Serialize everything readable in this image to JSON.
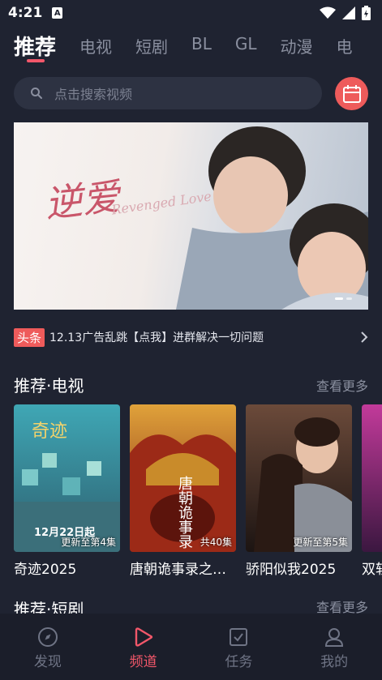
{
  "status_bar": {
    "time": "4:21",
    "notif_badge": "A"
  },
  "tabs": [
    {
      "label": "推荐",
      "active": true
    },
    {
      "label": "电视",
      "active": false
    },
    {
      "label": "短剧",
      "active": false
    },
    {
      "label": "BL",
      "active": false
    },
    {
      "label": "GL",
      "active": false
    },
    {
      "label": "动漫",
      "active": false
    },
    {
      "label": "电",
      "active": false
    }
  ],
  "search": {
    "placeholder": "点击搜索视频"
  },
  "banner": {
    "title_art": "逆爱",
    "subtitle_art": "Revenged Love"
  },
  "notice": {
    "tag": "头条",
    "text": "12.13广告乱跳【点我】进群解决一切问题"
  },
  "section_tv": {
    "title": "推荐·电视",
    "more": "查看更多"
  },
  "cards": [
    {
      "name": "奇迹2025",
      "badge": "更新至第4集",
      "poster_text": "12月22日起",
      "color_top": "#3fa7b5",
      "color_bottom": "#2d5e6e"
    },
    {
      "name": "唐朝诡事录之…",
      "badge": "共40集",
      "poster_text": "唐朝诡事录",
      "color_top": "#e0a23a",
      "color_bottom": "#7a1e12"
    },
    {
      "name": "骄阳似我2025",
      "badge": "更新至第5集",
      "poster_text": "",
      "color_top": "#6b4a3a",
      "color_bottom": "#1c1412"
    },
    {
      "name": "双轨",
      "badge": "",
      "poster_text": "",
      "color_top": "#c23a9a",
      "color_bottom": "#3b1740"
    }
  ],
  "section_short": {
    "title": "推荐·短剧",
    "more": "查看更多"
  },
  "bottom_nav": [
    {
      "label": "发现",
      "icon": "compass-icon",
      "active": false
    },
    {
      "label": "频道",
      "icon": "play-icon",
      "active": true
    },
    {
      "label": "任务",
      "icon": "checkbox-icon",
      "active": false
    },
    {
      "label": "我的",
      "icon": "user-icon",
      "active": false
    }
  ],
  "colors": {
    "accent": "#f2576a",
    "background": "#1f2331",
    "calendar_button": "#ee5b5b"
  }
}
